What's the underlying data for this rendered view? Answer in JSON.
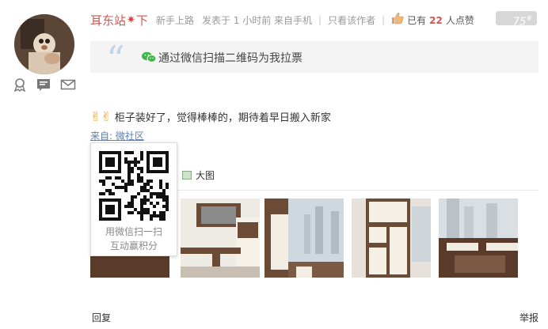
{
  "post": {
    "username": "耳东站",
    "rank_star": "✷",
    "rank_suffix": "下",
    "level": "新手上路",
    "posted": "发表于 1 小时前 来自手机",
    "only_author": "只看该作者",
    "likes_prefix": "已有",
    "likes_count": "22",
    "likes_suffix": "人点赞",
    "floor_number": "75",
    "floor_mark": "#",
    "quote_text": "通过微信扫描二维码为我拉票",
    "hands": "✌✌",
    "body_text": "柜子装好了，觉得棒棒的，期待着早日搬入新家",
    "source_label": "来自: 微社区",
    "qr_caption_line1": "用微信扫一扫",
    "qr_caption_line2": "互动赢积分",
    "big_image_label": "大图",
    "reply_label": "回复",
    "report_label": "举报"
  },
  "icons": {
    "medal": "medal-icon",
    "profile": "profile-card-icon",
    "message": "envelope-icon",
    "thumb": "thumbs-up-icon",
    "wechat": "wechat-icon"
  },
  "colors": {
    "username": "#d9534f",
    "likes_count": "#d9534f",
    "link": "#5a7fb5",
    "floor_badge": "#d7d7d7"
  }
}
